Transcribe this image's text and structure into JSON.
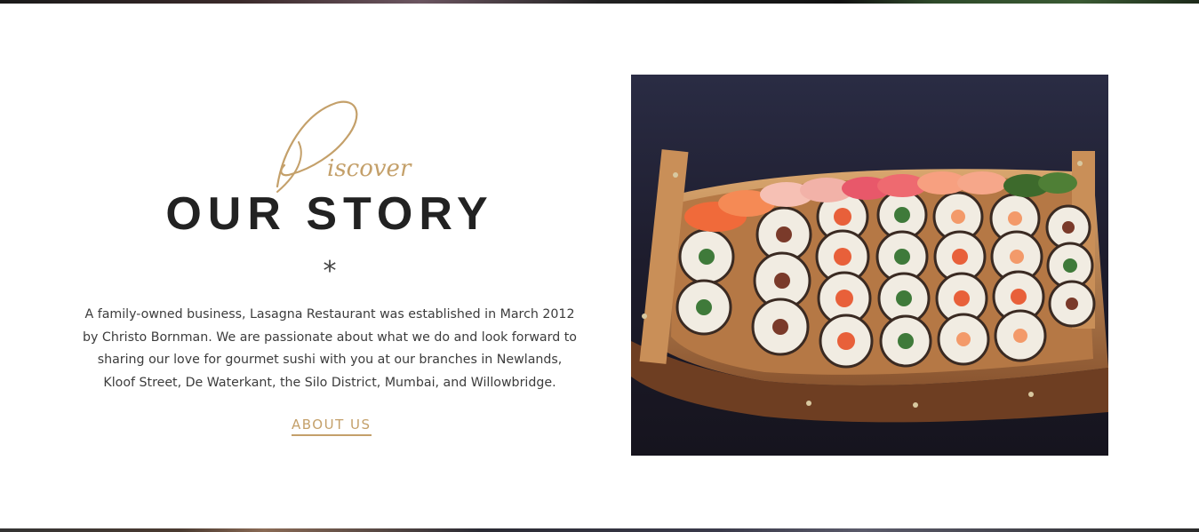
{
  "story": {
    "script_word": "Discover",
    "title": "OUR STORY",
    "divider": "*",
    "description": "A family-owned business, Lasagna Restaurant was established in March 2012 by Christo Bornman. We are passionate about what we do and look forward to sharing our love for gourmet sushi with you at our branches in Newlands, Kloof Street, De Waterkant, the Silo District, Mumbai, and Willowbridge.",
    "link_label": "ABOUT US"
  },
  "colors": {
    "accent_gold": "#c4a06a",
    "heading": "#222222",
    "body_text": "#3c3c3c"
  }
}
